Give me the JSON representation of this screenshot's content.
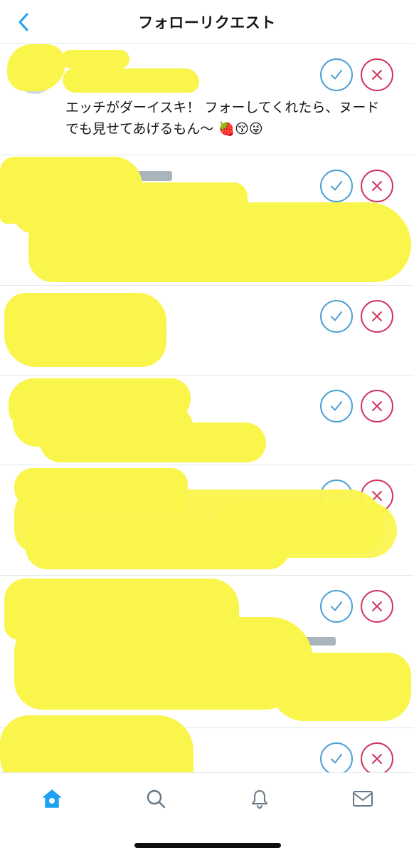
{
  "header": {
    "title": "フォローリクエスト",
    "back_icon": "chevron-left-icon"
  },
  "requests": [
    {
      "display_name": "",
      "handle": "",
      "bio": "エッチがダーイスキ！ フォーしてくれたら、ヌードでも見せてあげるもん〜 🍓😚😜"
    }
  ],
  "bottom_tabs": [
    {
      "icon": "home-icon",
      "active": true
    },
    {
      "icon": "search-icon",
      "active": false
    },
    {
      "icon": "bell-icon",
      "active": false
    },
    {
      "icon": "mail-icon",
      "active": false
    }
  ],
  "colors": {
    "accent": "#1da1f2",
    "accept": "#4c9fd6",
    "decline": "#d0355f",
    "redaction": "#faf54b"
  }
}
